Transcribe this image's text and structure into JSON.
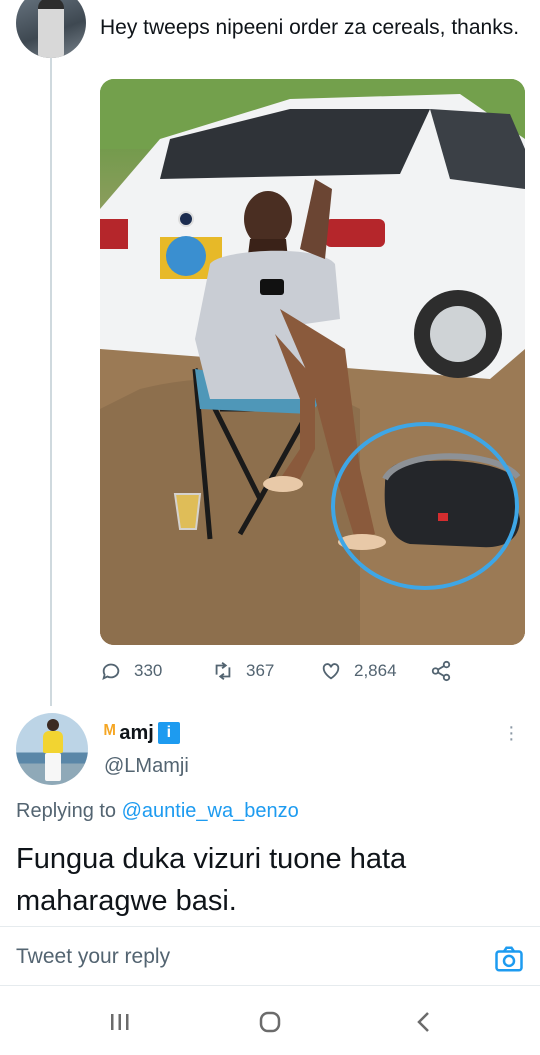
{
  "parent_tweet": {
    "text": "Hey tweeps nipeeni order za cereals, thanks.",
    "stats": {
      "replies": "330",
      "retweets": "367",
      "likes": "2,864"
    }
  },
  "reply_tweet": {
    "display_name": "amj",
    "handle": "@LMamji",
    "replying_label": "Replying to",
    "replying_to": "@auntie_wa_benzo",
    "text": "Fungua duka vizuri tuone hata maharagwe basi."
  },
  "composer": {
    "placeholder": "Tweet your reply"
  },
  "icons": {
    "reply": "reply-icon",
    "retweet": "retweet-icon",
    "like": "heart-icon",
    "share": "share-icon",
    "camera": "camera-icon",
    "more": "more-icon",
    "nav_recent": "recent-apps-icon",
    "nav_home": "home-icon",
    "nav_back": "back-icon"
  },
  "colors": {
    "accent": "#1d9bf0",
    "muted": "#536471",
    "text": "#0f1419",
    "highlight_circle": "#3ea6e6"
  }
}
